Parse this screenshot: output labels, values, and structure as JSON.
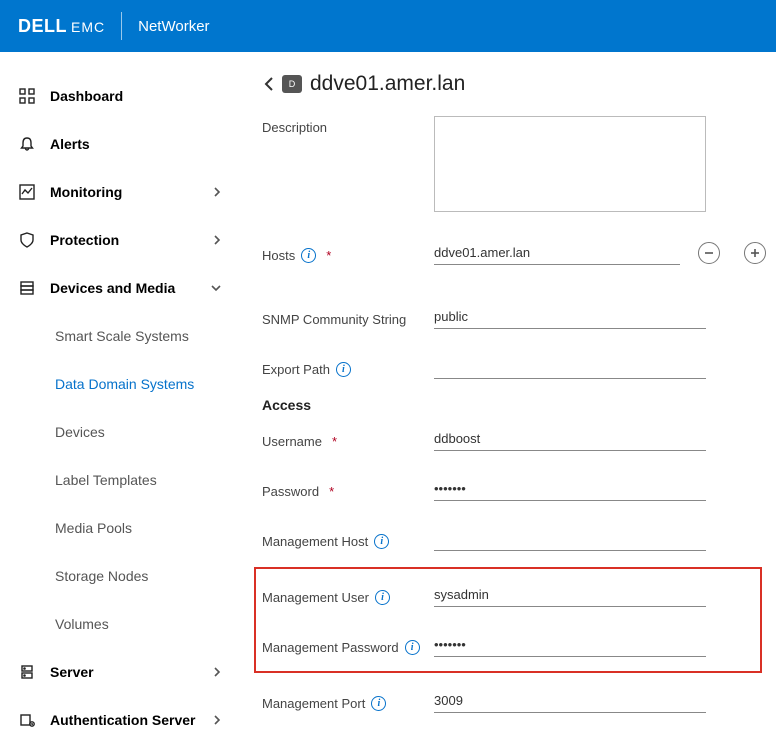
{
  "header": {
    "brand1": "DELL",
    "brand2": "EMC",
    "product": "NetWorker"
  },
  "sidebar": {
    "items": [
      {
        "label": "Dashboard",
        "icon": "dashboard",
        "chevron": false
      },
      {
        "label": "Alerts",
        "icon": "bell",
        "chevron": false
      },
      {
        "label": "Monitoring",
        "icon": "chart",
        "chevron": true
      },
      {
        "label": "Protection",
        "icon": "shield",
        "chevron": true
      },
      {
        "label": "Devices and Media",
        "icon": "storage",
        "chevron": true,
        "expanded": true
      },
      {
        "label": "Server",
        "icon": "server",
        "chevron": true
      },
      {
        "label": "Authentication Server",
        "icon": "auth",
        "chevron": true
      }
    ],
    "devicesSub": [
      {
        "label": "Smart Scale Systems"
      },
      {
        "label": "Data Domain Systems",
        "active": true
      },
      {
        "label": "Devices"
      },
      {
        "label": "Label Templates"
      },
      {
        "label": "Media Pools"
      },
      {
        "label": "Storage Nodes"
      },
      {
        "label": "Volumes"
      }
    ]
  },
  "page": {
    "title": "ddve01.amer.lan",
    "labels": {
      "description": "Description",
      "hosts": "Hosts",
      "snmp": "SNMP Community String",
      "exportPath": "Export Path",
      "access": "Access",
      "username": "Username",
      "password": "Password",
      "mgmtHost": "Management Host",
      "mgmtUser": "Management User",
      "mgmtPassword": "Management Password",
      "mgmtPort": "Management Port"
    },
    "values": {
      "description": "",
      "hosts": "ddve01.amer.lan",
      "snmp": "public",
      "exportPath": "",
      "username": "ddboost",
      "password": "•••••••",
      "mgmtHost": "",
      "mgmtUser": "sysadmin",
      "mgmtPassword": "•••••••",
      "mgmtPort": "3009"
    }
  }
}
